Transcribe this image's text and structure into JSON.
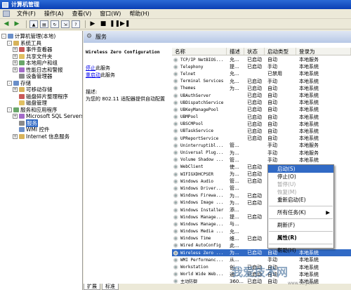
{
  "window": {
    "title": "计算机管理"
  },
  "menu": [
    "文件(F)",
    "操作(A)",
    "查看(V)",
    "窗口(W)",
    "帮助(H)"
  ],
  "toolbar": [
    "back-icon",
    "forward-icon",
    "up-icon",
    "properties-icon",
    "refresh-icon",
    "export-icon",
    "help-icon",
    "play-icon",
    "stop-icon",
    "pause-icon",
    "restart-icon"
  ],
  "tree": [
    {
      "label": "计算机管理(本地)",
      "level": 0,
      "expander": "-"
    },
    {
      "label": "系统工具",
      "level": 1,
      "expander": "-"
    },
    {
      "label": "事件查看器",
      "level": 2,
      "expander": "+"
    },
    {
      "label": "共享文件夹",
      "level": 2,
      "expander": "+"
    },
    {
      "label": "本地用户和组",
      "level": 2,
      "expander": "+"
    },
    {
      "label": "性能日志和警报",
      "level": 2,
      "expander": "+"
    },
    {
      "label": "设备管理器",
      "level": 2,
      "expander": ""
    },
    {
      "label": "存储",
      "level": 1,
      "expander": "-"
    },
    {
      "label": "可移动存储",
      "level": 2,
      "expander": "+"
    },
    {
      "label": "磁盘碎片整理程序",
      "level": 2,
      "expander": ""
    },
    {
      "label": "磁盘管理",
      "level": 2,
      "expander": ""
    },
    {
      "label": "服务和应用程序",
      "level": 1,
      "expander": "-"
    },
    {
      "label": "Microsoft SQL Servers",
      "level": 2,
      "expander": "+"
    },
    {
      "label": "服务",
      "level": 2,
      "expander": "",
      "selected": true
    },
    {
      "label": "WMI 控件",
      "level": 2,
      "expander": ""
    },
    {
      "label": "Internet 信息服务",
      "level": 2,
      "expander": "+"
    }
  ],
  "pane_header": "服务",
  "description": {
    "title": "Wireless Zero Configuration",
    "link_stop": "停止",
    "link_stop_suffix": "此服务",
    "link_restart": "重启动",
    "link_restart_suffix": "此服务",
    "desc_label": "描述:",
    "desc_text": "为您的 802.11 适配器提供自动配置"
  },
  "columns": [
    "名称",
    "描述",
    "状态",
    "启动类型",
    "登录为"
  ],
  "services": [
    {
      "name": "TCP/IP NetBIOS...",
      "desc": "允...",
      "status": "已启动",
      "startup": "自动",
      "logon": "本地服务"
    },
    {
      "name": "Telephony",
      "desc": "提...",
      "status": "已启动",
      "startup": "手动",
      "logon": "本地系统"
    },
    {
      "name": "Telnet",
      "desc": "允...",
      "status": "",
      "startup": "已禁用",
      "logon": "本地系统"
    },
    {
      "name": "Terminal Services",
      "desc": "允...",
      "status": "已启动",
      "startup": "手动",
      "logon": "本地系统"
    },
    {
      "name": "Themes",
      "desc": "为...",
      "status": "已启动",
      "startup": "自动",
      "logon": "本地系统"
    },
    {
      "name": "UBAuthServer",
      "desc": "",
      "status": "已启动",
      "startup": "自动",
      "logon": "本地系统"
    },
    {
      "name": "UBDispatchService",
      "desc": "",
      "status": "已启动",
      "startup": "自动",
      "logon": "本地系统"
    },
    {
      "name": "UBKeyManagePool",
      "desc": "",
      "status": "已启动",
      "startup": "自动",
      "logon": "本地系统"
    },
    {
      "name": "UBMPool",
      "desc": "",
      "status": "已启动",
      "startup": "自动",
      "logon": "本地系统"
    },
    {
      "name": "UBSCMPool",
      "desc": "",
      "status": "已启动",
      "startup": "自动",
      "logon": "本地系统"
    },
    {
      "name": "UBTaskService",
      "desc": "",
      "status": "已启动",
      "startup": "自动",
      "logon": "本地系统"
    },
    {
      "name": "UPReportService",
      "desc": "",
      "status": "已启动",
      "startup": "自动",
      "logon": "本地系统"
    },
    {
      "name": "Uninterruptibl...",
      "desc": "管...",
      "status": "",
      "startup": "手动",
      "logon": "本地服务"
    },
    {
      "name": "Universal Plug...",
      "desc": "为...",
      "status": "",
      "startup": "手动",
      "logon": "本地服务"
    },
    {
      "name": "Volume Shadow ...",
      "desc": "管...",
      "status": "",
      "startup": "手动",
      "logon": "本地系统"
    },
    {
      "name": "WebClient",
      "desc": "使...",
      "status": "已启动",
      "startup": "自动",
      "logon": "本地服务"
    },
    {
      "name": "WIFIGXDHCPSER",
      "desc": "为...",
      "status": "已启动",
      "startup": "自动",
      "logon": "本地系统"
    },
    {
      "name": "Windows Audio",
      "desc": "管...",
      "status": "已启动",
      "startup": "自动",
      "logon": "本地系统"
    },
    {
      "name": "Windows Driver...",
      "desc": "管...",
      "status": "",
      "startup": "手动",
      "logon": "本地系统"
    },
    {
      "name": "Windows Firewa...",
      "desc": "为...",
      "status": "已启动",
      "startup": "自动",
      "logon": "本地系统"
    },
    {
      "name": "Windows Image ...",
      "desc": "为...",
      "status": "已启动",
      "startup": "自动",
      "logon": "本地系统"
    },
    {
      "name": "Windows Installer",
      "desc": "添...",
      "status": "",
      "startup": "手动",
      "logon": "本地系统"
    },
    {
      "name": "Windows Manage...",
      "desc": "提...",
      "status": "已启动",
      "startup": "自动",
      "logon": "本地系统"
    },
    {
      "name": "Windows Manage...",
      "desc": "与...",
      "status": "",
      "startup": "手动",
      "logon": "本地系统"
    },
    {
      "name": "Windows Media ...",
      "desc": "允...",
      "status": "",
      "startup": "手动",
      "logon": "本地系统"
    },
    {
      "name": "Windows Time",
      "desc": "维...",
      "status": "已启动",
      "startup": "自动",
      "logon": "本地系统"
    },
    {
      "name": "Wired AutoConfig",
      "desc": "此...",
      "status": "",
      "startup": "手动",
      "logon": "本地系统"
    },
    {
      "name": "Wireless Zero ...",
      "desc": "为...",
      "status": "已启动",
      "startup": "自动",
      "logon": "本地系统",
      "selected": true
    },
    {
      "name": "WMI Performanc...",
      "desc": "从...",
      "status": "",
      "startup": "手动",
      "logon": "本地系统"
    },
    {
      "name": "Workstation",
      "desc": "创...",
      "status": "已启动",
      "startup": "自动",
      "logon": "本地系统"
    },
    {
      "name": "World Wide Web...",
      "desc": "通...",
      "status": "已启动",
      "startup": "自动",
      "logon": "本地系统"
    },
    {
      "name": "主动防御",
      "desc": "360...",
      "status": "已启动",
      "startup": "自动",
      "logon": "本地系统"
    }
  ],
  "context_menu": {
    "start": "启动(S)",
    "stop": "停止(O)",
    "pause": "暂停(U)",
    "resume": "恢复(M)",
    "restart": "重新启动(E)",
    "all_tasks": "所有任务(K)",
    "refresh": "刷新(F)",
    "properties": "属性(R)",
    "help": "帮助(H)"
  },
  "tabs": [
    "扩展",
    "标准"
  ],
  "watermark": {
    "text": "我爱技术网",
    "url": "www.52ij.com"
  },
  "colors": {
    "selection": "#316ac5",
    "titlebar": "#0a3fb4",
    "link": "#0000ee"
  }
}
